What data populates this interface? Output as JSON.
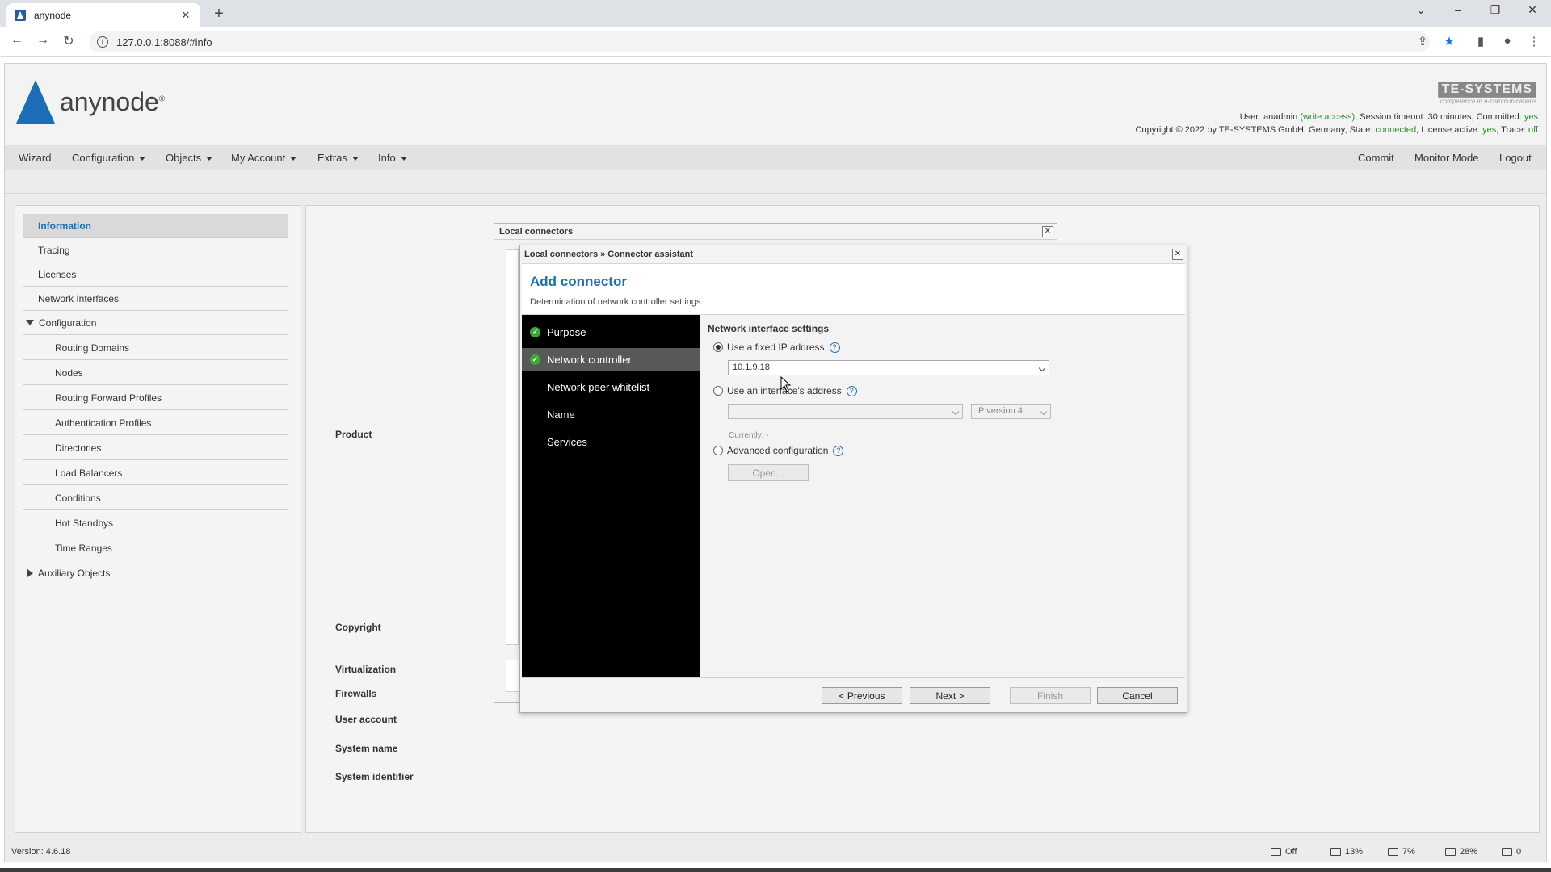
{
  "browser": {
    "tab_title": "anynode",
    "url": "127.0.0.1:8088/#info"
  },
  "header": {
    "logo_text": "anynode",
    "logo_sup": "®",
    "te_logo": "TE-SYSTEMS",
    "te_tagline": "competence in e-communications",
    "user_prefix": "User: ",
    "user": "anadmin",
    "write_access": "(write access)",
    "session": ", Session timeout: 30 minutes, Committed: ",
    "committed": "yes",
    "copyright_prefix": "Copyright © 2022 by TE-SYSTEMS GmbH, Germany, State: ",
    "state": "connected",
    "license_prefix": ", License active: ",
    "license": "yes",
    "trace_prefix": ", Trace: ",
    "trace": "off"
  },
  "menu": {
    "wizard": "Wizard",
    "configuration": "Configuration",
    "objects": "Objects",
    "my_account": "My Account",
    "extras": "Extras",
    "info": "Info",
    "commit": "Commit",
    "monitor_mode": "Monitor Mode",
    "logout": "Logout"
  },
  "sidebar": {
    "items": [
      {
        "label": "Information"
      },
      {
        "label": "Tracing"
      },
      {
        "label": "Licenses"
      },
      {
        "label": "Network Interfaces"
      },
      {
        "label": "Configuration"
      },
      {
        "label": "Routing Domains"
      },
      {
        "label": "Nodes"
      },
      {
        "label": "Routing Forward Profiles"
      },
      {
        "label": "Authentication Profiles"
      },
      {
        "label": "Directories"
      },
      {
        "label": "Load Balancers"
      },
      {
        "label": "Conditions"
      },
      {
        "label": "Hot Standbys"
      },
      {
        "label": "Time Ranges"
      },
      {
        "label": "Auxiliary Objects"
      }
    ]
  },
  "info_rows": {
    "product": "Product",
    "copyright": "Copyright",
    "virtualization": "Virtualization",
    "firewalls": "Firewalls",
    "user_account": "User account",
    "system_name": "System name",
    "system_identifier": "System identifier"
  },
  "bg_dialog": {
    "title": "Local connectors"
  },
  "dialog": {
    "title": "Local connectors » Connector assistant",
    "heading": "Add connector",
    "subtitle": "Determination of network controller settings.",
    "steps": [
      {
        "label": "Purpose",
        "done": true
      },
      {
        "label": "Network controller",
        "done": true
      },
      {
        "label": "Network peer whitelist",
        "done": false
      },
      {
        "label": "Name",
        "done": false
      },
      {
        "label": "Services",
        "done": false
      }
    ],
    "section_title": "Network interface settings",
    "fixed_ip_label": "Use a fixed IP address",
    "fixed_ip_value": "10.1.9.18",
    "interface_label": "Use an interface's address",
    "interface_value": "",
    "ip_version": "IP version 4",
    "currently": "Currently: -",
    "advanced_label": "Advanced configuration",
    "open_button": "Open...",
    "previous": "< Previous",
    "next": "Next >",
    "finish": "Finish",
    "cancel": "Cancel"
  },
  "status": {
    "version": "Version: 4.6.18",
    "s1": "Off",
    "s2": "13%",
    "s3": "7%",
    "s4": "28%",
    "s5": "0"
  },
  "colors": {
    "accent": "#1c6fb6",
    "ok": "#3aaa35",
    "highlight": "#2a8a2a"
  }
}
